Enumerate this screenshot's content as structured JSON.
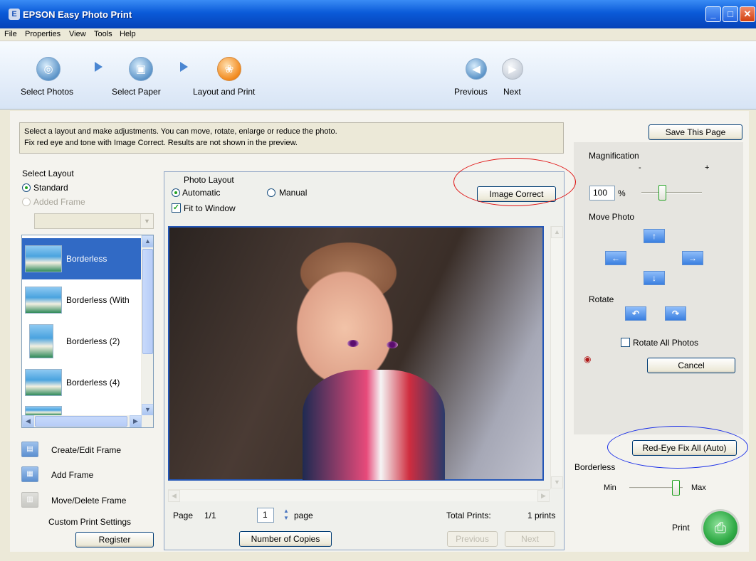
{
  "window": {
    "title": "EPSON Easy Photo Print",
    "app_icon": "epson-icon",
    "controls": [
      "minimize",
      "maximize",
      "close"
    ]
  },
  "menu": [
    "File",
    "Properties",
    "View",
    "Tools",
    "Help"
  ],
  "toolbar": {
    "steps": [
      {
        "label": "Select Photos",
        "icon": "select-photos-icon"
      },
      {
        "label": "Select Paper",
        "icon": "select-paper-icon"
      },
      {
        "label": "Layout and Print",
        "icon": "layout-print-icon"
      }
    ],
    "previous": "Previous",
    "next": "Next"
  },
  "instructions": {
    "line1": "Select a layout and make adjustments. You can move, rotate, enlarge or reduce the photo.",
    "line2": "Fix red eye and tone with Image Correct. Results are not shown in the preview."
  },
  "left": {
    "select_layout": "Select Layout",
    "standard": "Standard",
    "added_frame": "Added Frame",
    "layouts": [
      "Borderless",
      "Borderless (With",
      "Borderless (2)",
      "Borderless (4)"
    ],
    "create_edit_frame": "Create/Edit Frame",
    "add_frame": "Add Frame",
    "move_delete_frame": "Move/Delete Frame",
    "custom_print_settings": "Custom Print Settings",
    "register": "Register"
  },
  "center": {
    "photo_layout": "Photo Layout",
    "automatic": "Automatic",
    "manual": "Manual",
    "fit_to_window": "Fit to Window",
    "image_correct": "Image Correct",
    "page_label": "Page",
    "page_value": "1/1",
    "page_input": "1",
    "page_unit": "page",
    "total_prints_label": "Total Prints:",
    "total_prints_value": "1 prints",
    "number_of_copies": "Number of Copies",
    "previous": "Previous",
    "next": "Next"
  },
  "right": {
    "save_this_page": "Save This Page",
    "magnification": "Magnification",
    "minus": "-",
    "plus": "+",
    "mag_value": "100",
    "percent": "%",
    "move_photo": "Move Photo",
    "rotate": "Rotate",
    "rotate_all_photos": "Rotate All Photos",
    "cancel": "Cancel",
    "red_eye_fix_all": "Red-Eye Fix All (Auto)",
    "borderless": "Borderless",
    "min": "Min",
    "max": "Max",
    "print": "Print"
  },
  "annotation_colors": {
    "red": "#e01010",
    "blue": "#1a2fe8"
  }
}
